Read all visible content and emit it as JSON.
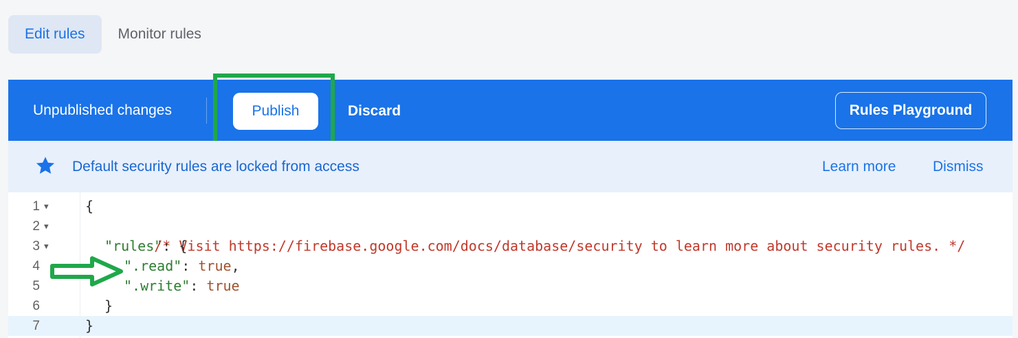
{
  "tabs": [
    {
      "label": "Edit rules",
      "active": true
    },
    {
      "label": "Monitor rules",
      "active": false
    }
  ],
  "toolbar": {
    "status_label": "Unpublished changes",
    "publish_label": "Publish",
    "discard_label": "Discard",
    "playground_label": "Rules Playground"
  },
  "banner": {
    "icon": "star-icon",
    "text": "Default security rules are locked from access",
    "learn_more_label": "Learn more",
    "dismiss_label": "Dismiss"
  },
  "editor": {
    "lines": [
      {
        "number": "1",
        "foldable": true,
        "text": "{"
      },
      {
        "number": "2",
        "foldable": true,
        "text": "/* Visit https://firebase.google.com/docs/database/security to learn more about security rules. */"
      },
      {
        "number": "3",
        "foldable": true,
        "key": "\"rules\"",
        "text": ": {"
      },
      {
        "number": "4",
        "foldable": false,
        "key": "\".read\"",
        "value": "true",
        "suffix": ","
      },
      {
        "number": "5",
        "foldable": false,
        "key": "\".write\"",
        "value": "true",
        "suffix": ""
      },
      {
        "number": "6",
        "foldable": false,
        "text": "}"
      },
      {
        "number": "7",
        "foldable": false,
        "text": "}"
      }
    ]
  },
  "colors": {
    "toolbar_bg": "#1a73e8",
    "highlight": "#1fa84a",
    "banner_bg": "#e8f0fb",
    "comment": "#c0392b",
    "key": "#2e7d32",
    "boolean": "#a0522d"
  }
}
